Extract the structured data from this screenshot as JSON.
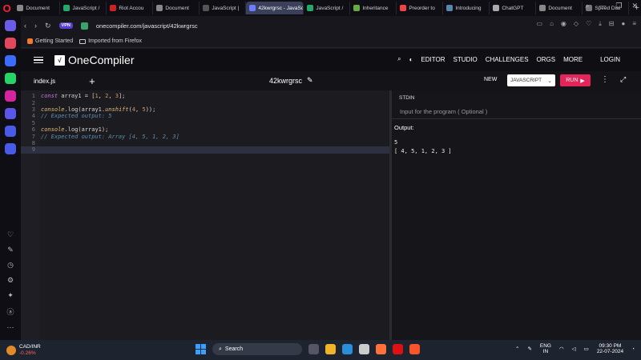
{
  "browser": {
    "tabs": [
      {
        "label": "Document",
        "color": "#888"
      },
      {
        "label": "JavaScript /",
        "color": "#2a6"
      },
      {
        "label": "Riot Accou",
        "color": "#c22"
      },
      {
        "label": "Document",
        "color": "#888"
      },
      {
        "label": "JavaScript |",
        "color": "#555"
      },
      {
        "label": "42kwrgrsc - JavaScr",
        "color": "#6b7cff",
        "active": true
      },
      {
        "label": "JavaScript /",
        "color": "#2a6"
      },
      {
        "label": "Inheritance",
        "color": "#6a4"
      },
      {
        "label": "Preorder to",
        "color": "#e44"
      },
      {
        "label": "Introducing",
        "color": "#58a"
      },
      {
        "label": "ChatGPT",
        "color": "#aaa"
      },
      {
        "label": "Document",
        "color": "#888"
      },
      {
        "label": "Speed Dial",
        "color": "#777"
      }
    ],
    "new_tab": "+",
    "url": "onecompiler.com/javascript/42kwrgrsc",
    "vpn_label": "VPN",
    "bookmarks": [
      {
        "label": "Getting Started"
      },
      {
        "label": "Imported from Firefox"
      }
    ]
  },
  "sidebar": {
    "icons": [
      {
        "name": "home-icon",
        "color": "#6b5ce7"
      },
      {
        "name": "aria-icon",
        "color": "#e2475b"
      },
      {
        "name": "messenger-icon",
        "color": "#3b6bff"
      },
      {
        "name": "whatsapp-icon",
        "color": "#25d366"
      },
      {
        "name": "instagram-icon",
        "color": "#d6249f"
      },
      {
        "name": "player-icon",
        "color": "#5a57e8"
      },
      {
        "name": "send-icon",
        "color": "#4a5ae8"
      },
      {
        "name": "tv-icon",
        "color": "#4a5ae8"
      }
    ]
  },
  "app": {
    "logo_text": "OneCompiler",
    "nav": [
      "EDITOR",
      "STUDIO",
      "CHALLENGES",
      "ORGS",
      "MORE"
    ],
    "login": "LOGIN",
    "file_tab": "index.js",
    "project_name": "42kwrgrsc",
    "new_label": "NEW",
    "language": "JAVASCRIPT",
    "run_label": "RUN"
  },
  "editor": {
    "lines": [
      {
        "n": "1",
        "html": "<span class=\"kw\">const</span> array1 = [<span class=\"num\">1</span>, <span class=\"num\">2</span>, <span class=\"num\">3</span>];"
      },
      {
        "n": "2",
        "html": ""
      },
      {
        "n": "3",
        "html": "<span class=\"fn\">console</span>.log(array1.<span class=\"fn\">unshift</span>(<span class=\"num\">4</span>, <span class=\"num\">5</span>));"
      },
      {
        "n": "4",
        "html": "<span class=\"cmt\">// Expected output: 5</span>"
      },
      {
        "n": "5",
        "html": ""
      },
      {
        "n": "6",
        "html": "<span class=\"fn\">console</span>.log(array1);"
      },
      {
        "n": "7",
        "html": "<span class=\"cmt\">// Expected output: Array [4, 5, 1, 2, 3]</span>"
      },
      {
        "n": "8",
        "html": ""
      },
      {
        "n": "9",
        "html": "",
        "active": true
      }
    ]
  },
  "io": {
    "stdin_label": "STDIN",
    "stdin_placeholder": "Input for the program ( Optional )",
    "output_label": "Output:",
    "output_text": "5\n[ 4, 5, 1, 2, 3 ]"
  },
  "taskbar": {
    "ticker": "CAD/INR",
    "change": "-0.26%",
    "search": "Search",
    "lang_top": "ENG",
    "lang_bottom": "IN",
    "time": "09:30 PM",
    "date": "22-07-2024"
  }
}
